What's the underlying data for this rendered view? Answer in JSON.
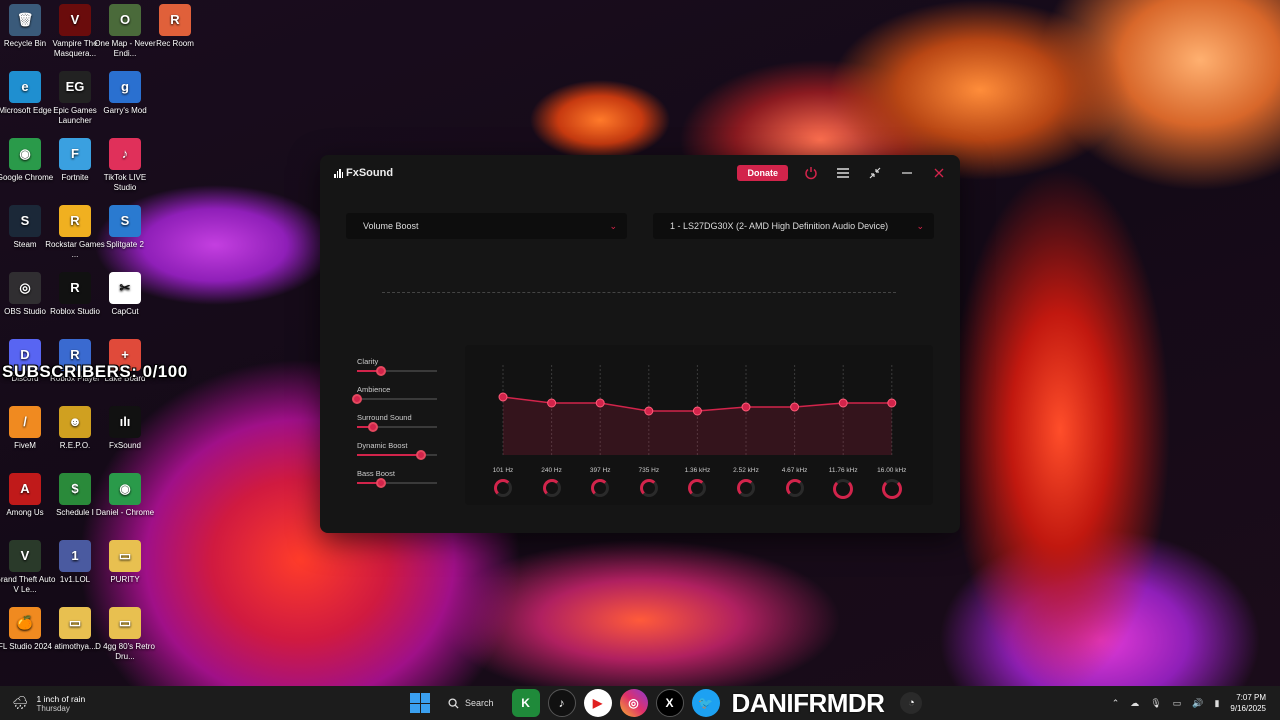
{
  "desktop": {
    "icons": [
      {
        "label": "Recycle Bin",
        "color": "#3a5a7a",
        "glyph": "🗑"
      },
      {
        "label": "Vampire The Masquera...",
        "color": "#6a0c0c",
        "glyph": "V"
      },
      {
        "label": "One Map - Never Endi...",
        "color": "#4a6a3a",
        "glyph": "O"
      },
      {
        "label": "Rec Room",
        "color": "#e0603a",
        "glyph": "R"
      },
      {
        "label": "Microsoft Edge",
        "color": "#1f8fd0",
        "glyph": "e"
      },
      {
        "label": "Epic Games Launcher",
        "color": "#222",
        "glyph": "EG"
      },
      {
        "label": "Garry's Mod",
        "color": "#2a70d0",
        "glyph": "g"
      },
      {
        "label": "Google Chrome",
        "color": "#2a9a4a",
        "glyph": "◉"
      },
      {
        "label": "Fortnite",
        "color": "#3aa0e0",
        "glyph": "F"
      },
      {
        "label": "TikTok LIVE Studio",
        "color": "#e0305a",
        "glyph": "♪"
      },
      {
        "label": "Steam",
        "color": "#1b2838",
        "glyph": "S"
      },
      {
        "label": "Rockstar Games ...",
        "color": "#f0b020",
        "glyph": "R"
      },
      {
        "label": "Splitgate 2",
        "color": "#2a7ad0",
        "glyph": "S"
      },
      {
        "label": "OBS Studio",
        "color": "#302e31",
        "glyph": "◎"
      },
      {
        "label": "Roblox Studio",
        "color": "#111",
        "glyph": "R"
      },
      {
        "label": "CapCut",
        "color": "#fff",
        "glyph": "✂"
      },
      {
        "label": "Discord",
        "color": "#5865f2",
        "glyph": "D"
      },
      {
        "label": "Roblox Player",
        "color": "#3a6ad0",
        "glyph": "R"
      },
      {
        "label": "Lake Board",
        "color": "#e04a3a",
        "glyph": "+"
      },
      {
        "label": "FiveM",
        "color": "#f08a20",
        "glyph": "/"
      },
      {
        "label": "R.E.P.O.",
        "color": "#d0a020",
        "glyph": "☻"
      },
      {
        "label": "FxSound",
        "color": "#111",
        "glyph": "ılı"
      },
      {
        "label": "Among Us",
        "color": "#c01a1a",
        "glyph": "A"
      },
      {
        "label": "Schedule I",
        "color": "#2a8a3a",
        "glyph": "$"
      },
      {
        "label": "Daniel - Chrome",
        "color": "#2a9a4a",
        "glyph": "◉"
      },
      {
        "label": "Grand Theft Auto V Le...",
        "color": "#2a3a2a",
        "glyph": "V"
      },
      {
        "label": "1v1.LOL",
        "color": "#4a5aa0",
        "glyph": "1"
      },
      {
        "label": "PURITY",
        "color": "#e8c050",
        "glyph": "▭"
      },
      {
        "label": "FL Studio 2024",
        "color": "#f08a20",
        "glyph": "🍊"
      },
      {
        "label": "atimothya...",
        "color": "#e8c050",
        "glyph": "▭"
      },
      {
        "label": "D 4gg 80's Retro Dru...",
        "color": "#e8c050",
        "glyph": "▭"
      }
    ],
    "overlay_text": "SUBSCRIBERS: 0/100"
  },
  "app": {
    "name": "FxSound",
    "donate_label": "Donate",
    "preset_select": "Volume Boost",
    "device_select": "1 - LS27DG30X (2- AMD High Definition Audio Device)",
    "effects": [
      {
        "label": "Clarity",
        "level": 0.3
      },
      {
        "label": "Ambience",
        "level": 0.0
      },
      {
        "label": "Surround Sound",
        "level": 0.2
      },
      {
        "label": "Dynamic Boost",
        "level": 0.8
      },
      {
        "label": "Bass Boost",
        "level": 0.3
      }
    ],
    "eq_bands": [
      {
        "freq": "101 Hz",
        "gain": 0.15
      },
      {
        "freq": "240 Hz",
        "gain": 0.0
      },
      {
        "freq": "397 Hz",
        "gain": 0.0
      },
      {
        "freq": "735 Hz",
        "gain": -0.2
      },
      {
        "freq": "1.36 kHz",
        "gain": -0.2
      },
      {
        "freq": "2.52 kHz",
        "gain": -0.1
      },
      {
        "freq": "4.67 kHz",
        "gain": -0.1
      },
      {
        "freq": "11.76 kHz",
        "gain": 0.0
      },
      {
        "freq": "16.00 kHz",
        "gain": 0.0
      }
    ]
  },
  "taskbar": {
    "weather_line1": "1 inch of rain",
    "weather_line2": "Thursday",
    "search_label": "Search",
    "brand_text": "DANIFRMDR",
    "time": "7:07 PM",
    "date": "9/16/2025"
  },
  "colors": {
    "accent": "#d2244b"
  }
}
